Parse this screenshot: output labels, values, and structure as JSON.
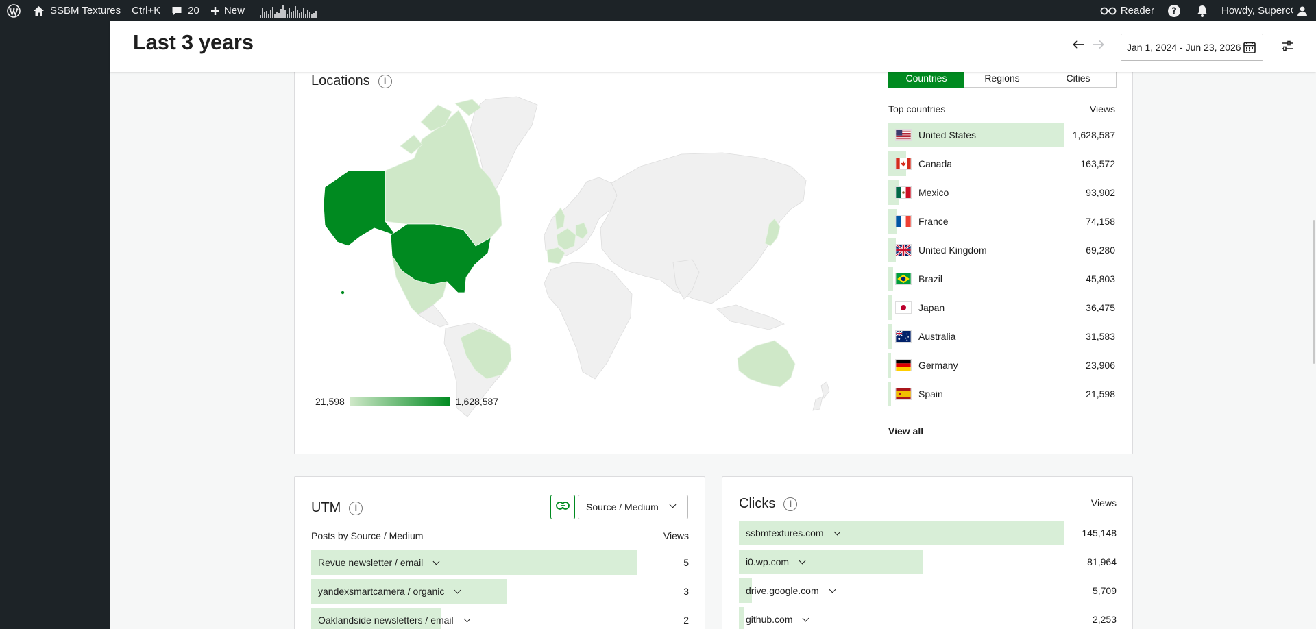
{
  "admin_bar": {
    "site_name": "SSBM Textures",
    "shortcut": "Ctrl+K",
    "comments_count": "20",
    "new_label": "New",
    "reader_label": "Reader",
    "howdy": "Howdy, SupercCres"
  },
  "header": {
    "title": "Last 3 years",
    "date_range": "Jan 1, 2024 - Jun 23, 2026"
  },
  "locations": {
    "title": "Locations",
    "tabs": [
      {
        "label": "Countries",
        "active": true
      },
      {
        "label": "Regions",
        "active": false
      },
      {
        "label": "Cities",
        "active": false
      }
    ],
    "list_header": "Top countries",
    "views_header": "Views",
    "legend_min": "21,598",
    "legend_max": "1,628,587",
    "countries": [
      {
        "name": "United States",
        "views": "1,628,587",
        "value": 1628587
      },
      {
        "name": "Canada",
        "views": "163,572",
        "value": 163572
      },
      {
        "name": "Mexico",
        "views": "93,902",
        "value": 93902
      },
      {
        "name": "France",
        "views": "74,158",
        "value": 74158
      },
      {
        "name": "United Kingdom",
        "views": "69,280",
        "value": 69280
      },
      {
        "name": "Brazil",
        "views": "45,803",
        "value": 45803
      },
      {
        "name": "Japan",
        "views": "36,475",
        "value": 36475
      },
      {
        "name": "Australia",
        "views": "31,583",
        "value": 31583
      },
      {
        "name": "Germany",
        "views": "23,906",
        "value": 23906
      },
      {
        "name": "Spain",
        "views": "21,598",
        "value": 21598
      }
    ],
    "view_all": "View all"
  },
  "utm": {
    "title": "UTM",
    "select_value": "Source / Medium",
    "list_header": "Posts by Source / Medium",
    "views_header": "Views",
    "rows": [
      {
        "label": "Revue newsletter / email",
        "views": "5",
        "value": 5
      },
      {
        "label": "yandexsmartcamera / organic",
        "views": "3",
        "value": 3
      },
      {
        "label": "Oaklandside newsletters / email",
        "views": "2",
        "value": 2
      }
    ]
  },
  "clicks": {
    "title": "Clicks",
    "views_header": "Views",
    "rows": [
      {
        "label": "ssbmtextures.com",
        "views": "145,148",
        "value": 145148
      },
      {
        "label": "i0.wp.com",
        "views": "81,964",
        "value": 81964
      },
      {
        "label": "drive.google.com",
        "views": "5,709",
        "value": 5709
      },
      {
        "label": "github.com",
        "views": "2,253",
        "value": 2253
      }
    ]
  },
  "colors": {
    "accent": "#008a20",
    "bar_fill": "#d8eed7",
    "map_light": "#cfe8c8",
    "map_base": "#f0f0f0"
  }
}
